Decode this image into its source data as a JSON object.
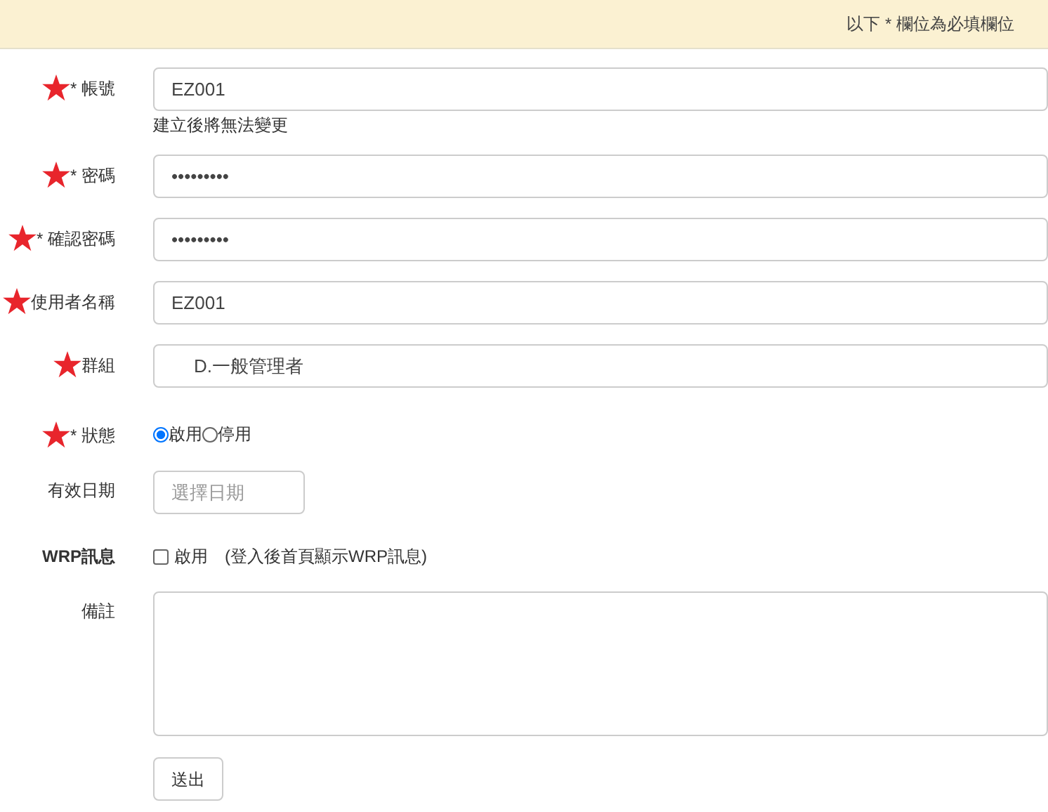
{
  "banner": {
    "text": "以下 * 欄位為必填欄位"
  },
  "fields": [
    {
      "kind": "text",
      "required": true,
      "label": "* 帳號",
      "value": "EZ001",
      "hint": "建立後將無法變更"
    },
    {
      "kind": "text",
      "required": true,
      "label": "* 密碼",
      "value": "•••••••••"
    },
    {
      "kind": "text",
      "required": true,
      "label": "* 確認密碼",
      "value": "•••••••••"
    },
    {
      "kind": "text",
      "required": true,
      "label": "使用者名稱",
      "value": "EZ001"
    },
    {
      "kind": "select",
      "required": true,
      "label": "群組",
      "value": "D.一般管理者"
    },
    {
      "kind": "radio",
      "required": true,
      "label": "* 狀態",
      "options": [
        {
          "label": "啟用",
          "selected": true
        },
        {
          "label": "停用",
          "selected": false
        }
      ]
    },
    {
      "kind": "date",
      "required": false,
      "label": "有效日期",
      "placeholder": "選擇日期"
    },
    {
      "kind": "checkbox",
      "required": false,
      "label": "WRP訊息",
      "option": "啟用",
      "checked": false,
      "note": "(登入後首頁顯示WRP訊息)"
    },
    {
      "kind": "textarea",
      "required": false,
      "label": "備註"
    }
  ],
  "submit": "送出"
}
